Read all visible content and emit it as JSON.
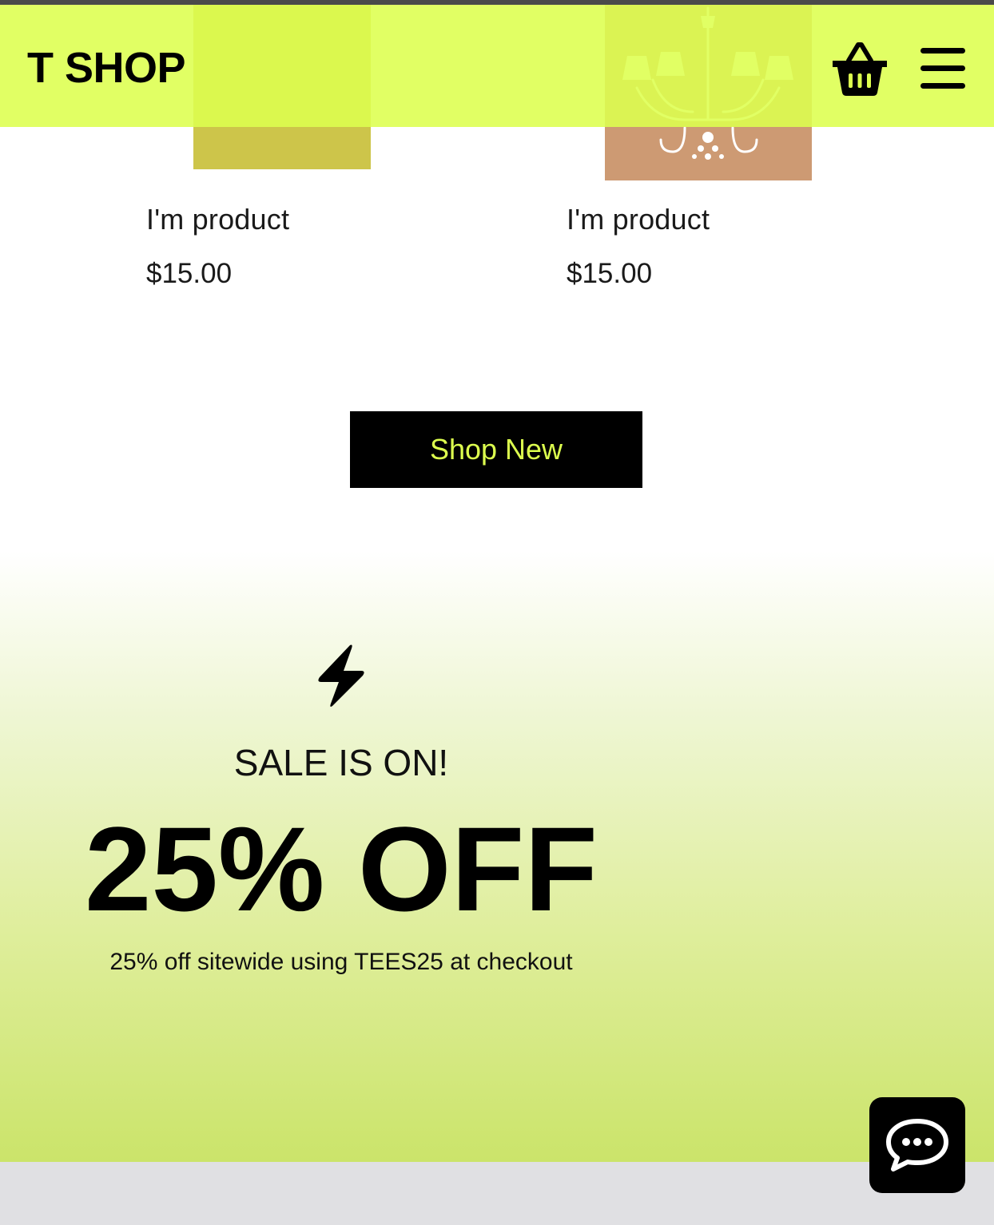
{
  "header": {
    "logo": "T SHOP",
    "cart_icon": "shopping-basket-icon",
    "menu_icon": "hamburger-menu-icon"
  },
  "products": [
    {
      "name": "I'm product",
      "price": "$15.00"
    },
    {
      "name": "I'm product",
      "price": "$15.00"
    }
  ],
  "shop_button": {
    "label": "Shop New"
  },
  "sale": {
    "icon": "lightning-bolt-icon",
    "label": "SALE IS ON!",
    "headline": "25% OFF",
    "detail": "25% off sitewide using TEES25 at checkout"
  },
  "chat": {
    "icon": "chat-bubble-icon"
  },
  "colors": {
    "accent": "#ddff4e",
    "button_bg": "#000000",
    "product_1_image": "#cdc54a",
    "product_2_image": "#cd9a73"
  }
}
